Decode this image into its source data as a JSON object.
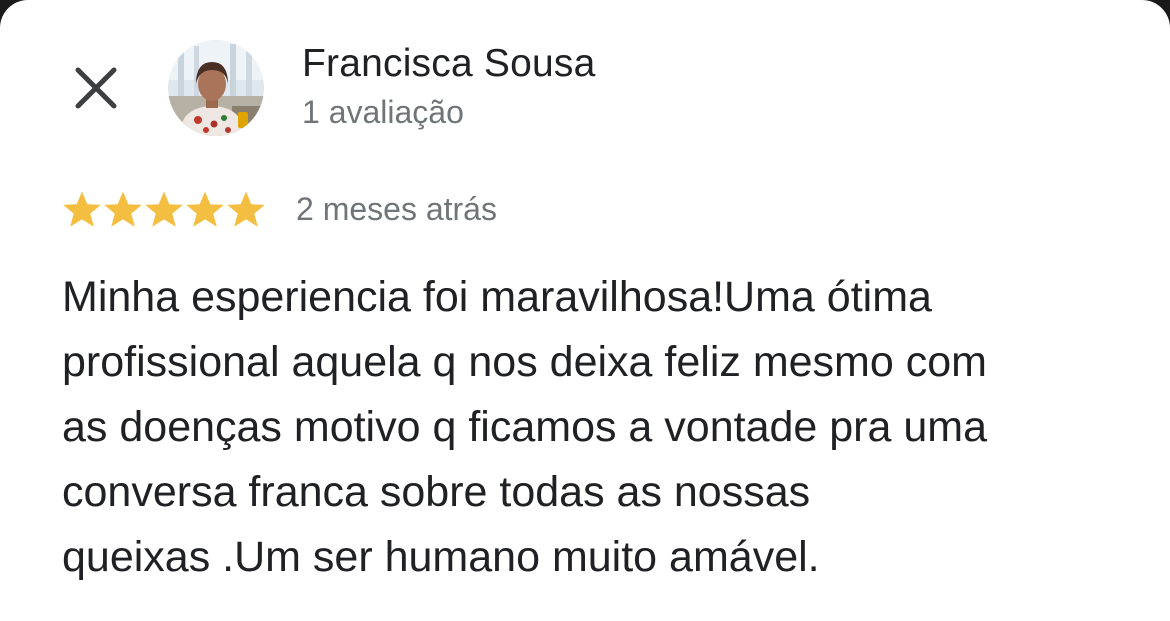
{
  "author": {
    "name": "Francisca Sousa",
    "review_count": "1 avaliação",
    "avatar": "profile-photo"
  },
  "review": {
    "rating": 5,
    "max_rating": 5,
    "time_ago": "2 meses atrás",
    "text_lines": [
      "Minha esperiencia foi maravilhosa!Uma ótima",
      "profissional aquela q nos deixa feliz mesmo com",
      "as doenças motivo q ficamos a vontade pra uma",
      "conversa franca sobre todas as nossas",
      "queixas .Um ser humano muito amável."
    ]
  },
  "icons": {
    "close": "close-icon",
    "star": "star-icon"
  },
  "colors": {
    "background": "#ffffff",
    "star": "#f4bf40",
    "text_primary": "#202124",
    "text_secondary": "#70757a"
  }
}
